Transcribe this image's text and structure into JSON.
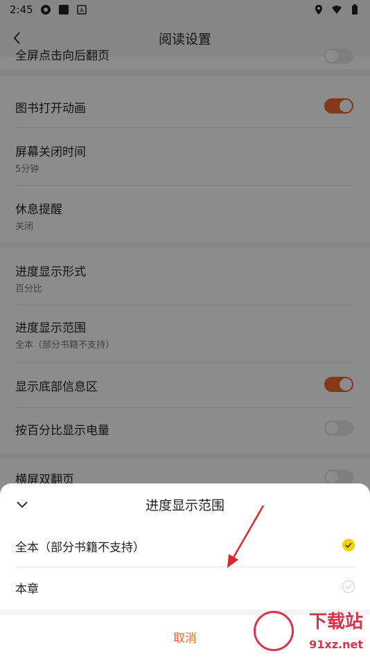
{
  "status_bar": {
    "time": "2:45"
  },
  "header": {
    "title": "阅读设置"
  },
  "settings": [
    {
      "title": "全屏点击向后翻页",
      "toggle": false
    },
    {
      "title": "图书打开动画",
      "toggle": true
    },
    {
      "title": "屏幕关闭时间",
      "subtitle": "5分钟"
    },
    {
      "title": "休息提醒",
      "subtitle": "关闭"
    },
    {
      "title": "进度显示形式",
      "subtitle": "百分比"
    },
    {
      "title": "进度显示范围",
      "subtitle": "全本（部分书籍不支持）"
    },
    {
      "title": "显示底部信息区",
      "toggle": true
    },
    {
      "title": "按百分比显示电量",
      "toggle": false
    },
    {
      "title": "横屏双翻页",
      "toggle": false
    }
  ],
  "sheet": {
    "title": "进度显示范围",
    "options": [
      {
        "label": "全本（部分书籍不支持）",
        "selected": true
      },
      {
        "label": "本章",
        "selected": false
      }
    ],
    "cancel_label": "取消"
  },
  "watermark": {
    "main": "下载站",
    "sub": "91xz.net"
  },
  "colors": {
    "accent": "#f0662b",
    "selected_check": "#f4d000"
  }
}
